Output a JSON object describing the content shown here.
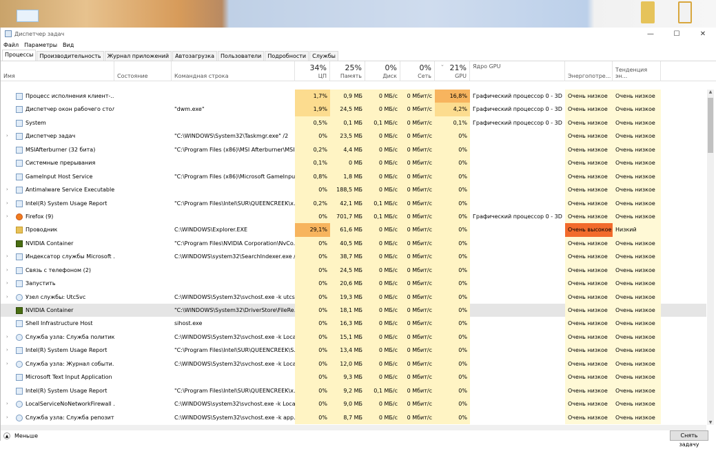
{
  "window": {
    "title": "Диспетчер задач",
    "controls": [
      "—",
      "☐",
      "✕"
    ]
  },
  "menu": [
    "Файл",
    "Параметры",
    "Вид"
  ],
  "tabs": [
    "Процессы",
    "Производительность",
    "Журнал приложений",
    "Автозагрузка",
    "Пользователи",
    "Подробности",
    "Службы"
  ],
  "columns": {
    "name": "Имя",
    "status": "Состояние",
    "cmd": "Командная строка",
    "cpu": {
      "pct": "34%",
      "label": "ЦП"
    },
    "mem": {
      "pct": "25%",
      "label": "Память"
    },
    "disk": {
      "pct": "0%",
      "label": "Диск"
    },
    "net": {
      "pct": "0%",
      "label": "Сеть"
    },
    "gpu": {
      "pct": "21%",
      "label": "GPU"
    },
    "gpuengine": "Ядро GPU",
    "power": "Энергопотре...",
    "trend": "Тенденция эн..."
  },
  "processes": [
    {
      "name": "Процесс исполнения клиент-...",
      "icon": "app-icon",
      "expand": false,
      "cmd": "",
      "cpu": "1,7%",
      "mem": "0,9 МБ",
      "disk": "0 МБ/с",
      "net": "0 Мбит/с",
      "gpu": "16,8%",
      "engine": "Графический процессор 0 - 3D",
      "power": "Очень низкое",
      "trend": "Очень низкое"
    },
    {
      "name": "Диспетчер окон рабочего стола",
      "icon": "app-icon",
      "expand": false,
      "cmd": "\"dwm.exe\"",
      "cpu": "1,9%",
      "mem": "24,5 МБ",
      "disk": "0 МБ/с",
      "net": "0 Мбит/с",
      "gpu": "4,2%",
      "engine": "Графический процессор 0 - 3D",
      "power": "Очень низкое",
      "trend": "Очень низкое"
    },
    {
      "name": "System",
      "icon": "app-icon",
      "expand": false,
      "cmd": "",
      "cpu": "0,5%",
      "mem": "0,1 МБ",
      "disk": "0,1 МБ/с",
      "net": "0 Мбит/с",
      "gpu": "0,1%",
      "engine": "Графический процессор 0 - 3D",
      "power": "Очень низкое",
      "trend": "Очень низкое"
    },
    {
      "name": "Диспетчер задач",
      "icon": "taskmgr-icon",
      "expand": true,
      "cmd": "\"C:\\WINDOWS\\System32\\Taskmgr.exe\" /2",
      "cpu": "0%",
      "mem": "23,5 МБ",
      "disk": "0 МБ/с",
      "net": "0 Мбит/с",
      "gpu": "0%",
      "engine": "",
      "power": "Очень низкое",
      "trend": "Очень низкое"
    },
    {
      "name": "MSIAfterburner (32 бита)",
      "icon": "app-icon",
      "expand": false,
      "cmd": "\"C:\\Program Files (x86)\\MSI Afterburner\\MSI...",
      "cpu": "0,2%",
      "mem": "4,4 МБ",
      "disk": "0 МБ/с",
      "net": "0 Мбит/с",
      "gpu": "0%",
      "engine": "",
      "power": "Очень низкое",
      "trend": "Очень низкое"
    },
    {
      "name": "Системные прерывания",
      "icon": "app-icon",
      "expand": false,
      "cmd": "",
      "cpu": "0,1%",
      "mem": "0 МБ",
      "disk": "0 МБ/с",
      "net": "0 Мбит/с",
      "gpu": "0%",
      "engine": "",
      "power": "Очень низкое",
      "trend": "Очень низкое"
    },
    {
      "name": "GameInput Host Service",
      "icon": "app-icon",
      "expand": false,
      "cmd": "\"C:\\Program Files (x86)\\Microsoft GameInpu...",
      "cpu": "0,8%",
      "mem": "1,8 МБ",
      "disk": "0 МБ/с",
      "net": "0 Мбит/с",
      "gpu": "0%",
      "engine": "",
      "power": "Очень низкое",
      "trend": "Очень низкое"
    },
    {
      "name": "Antimalware Service Executable",
      "icon": "app-icon",
      "expand": true,
      "cmd": "",
      "cpu": "0%",
      "mem": "188,5 МБ",
      "disk": "0 МБ/с",
      "net": "0 Мбит/с",
      "gpu": "0%",
      "engine": "",
      "power": "Очень низкое",
      "trend": "Очень низкое"
    },
    {
      "name": "Intel(R) System Usage Report",
      "icon": "app-icon",
      "expand": true,
      "cmd": "\"C:\\Program Files\\Intel\\SUR\\QUEENCREEK\\x...",
      "cpu": "0,2%",
      "mem": "42,1 МБ",
      "disk": "0,1 МБ/с",
      "net": "0 Мбит/с",
      "gpu": "0%",
      "engine": "",
      "power": "Очень низкое",
      "trend": "Очень низкое"
    },
    {
      "name": "Firefox (9)",
      "icon": "firefox-icon",
      "expand": true,
      "cmd": "",
      "cpu": "0%",
      "mem": "701,7 МБ",
      "disk": "0,1 МБ/с",
      "net": "0 Мбит/с",
      "gpu": "0%",
      "engine": "Графический процессор 0 - 3D",
      "power": "Очень низкое",
      "trend": "Очень низкое"
    },
    {
      "name": "Проводник",
      "icon": "folder-icon",
      "expand": false,
      "cmd": "C:\\WINDOWS\\Explorer.EXE",
      "cpu": "29,1%",
      "mem": "61,6 МБ",
      "disk": "0 МБ/с",
      "net": "0 Мбит/с",
      "gpu": "0%",
      "engine": "",
      "power": "Очень высокое",
      "trend": "Низкий"
    },
    {
      "name": "NVIDIA Container",
      "icon": "nvidia-icon",
      "expand": false,
      "cmd": "\"C:\\Program Files\\NVIDIA Corporation\\NvCo...",
      "cpu": "0%",
      "mem": "40,5 МБ",
      "disk": "0 МБ/с",
      "net": "0 Мбит/с",
      "gpu": "0%",
      "engine": "",
      "power": "Очень низкое",
      "trend": "Очень низкое"
    },
    {
      "name": "Индексатор службы Microsoft ...",
      "icon": "app-icon",
      "expand": true,
      "cmd": "C:\\WINDOWS\\system32\\SearchIndexer.exe /...",
      "cpu": "0%",
      "mem": "38,7 МБ",
      "disk": "0 МБ/с",
      "net": "0 Мбит/с",
      "gpu": "0%",
      "engine": "",
      "power": "Очень низкое",
      "trend": "Очень низкое"
    },
    {
      "name": "Связь с телефоном (2)",
      "icon": "app-icon",
      "expand": true,
      "cmd": "",
      "cpu": "0%",
      "mem": "24,5 МБ",
      "disk": "0 МБ/с",
      "net": "0 Мбит/с",
      "gpu": "0%",
      "engine": "",
      "power": "Очень низкое",
      "trend": "Очень низкое"
    },
    {
      "name": "Запустить",
      "icon": "app-icon",
      "expand": true,
      "cmd": "",
      "cpu": "0%",
      "mem": "20,6 МБ",
      "disk": "0 МБ/с",
      "net": "0 Мбит/с",
      "gpu": "0%",
      "engine": "",
      "power": "Очень низкое",
      "trend": "Очень низкое"
    },
    {
      "name": "Узел службы: UtcSvc",
      "icon": "gear-icon",
      "expand": true,
      "cmd": "C:\\WINDOWS\\System32\\svchost.exe -k utcs...",
      "cpu": "0%",
      "mem": "19,3 МБ",
      "disk": "0 МБ/с",
      "net": "0 Мбит/с",
      "gpu": "0%",
      "engine": "",
      "power": "Очень низкое",
      "trend": "Очень низкое"
    },
    {
      "name": "NVIDIA Container",
      "icon": "nvidia-icon",
      "expand": false,
      "cmd": "\"C:\\WINDOWS\\System32\\DriverStore\\FileRe...",
      "cpu": "0%",
      "mem": "18,1 МБ",
      "disk": "0 МБ/с",
      "net": "0 Мбит/с",
      "gpu": "0%",
      "engine": "",
      "power": "Очень низкое",
      "trend": "Очень низкое",
      "selected": true
    },
    {
      "name": "Shell Infrastructure Host",
      "icon": "app-icon",
      "expand": false,
      "cmd": "sihost.exe",
      "cpu": "0%",
      "mem": "16,3 МБ",
      "disk": "0 МБ/с",
      "net": "0 Мбит/с",
      "gpu": "0%",
      "engine": "",
      "power": "Очень низкое",
      "trend": "Очень низкое"
    },
    {
      "name": "Служба узла: Служба политик...",
      "icon": "gear-icon",
      "expand": true,
      "cmd": "C:\\WINDOWS\\System32\\svchost.exe -k Loca...",
      "cpu": "0%",
      "mem": "15,1 МБ",
      "disk": "0 МБ/с",
      "net": "0 Мбит/с",
      "gpu": "0%",
      "engine": "",
      "power": "Очень низкое",
      "trend": "Очень низкое"
    },
    {
      "name": "Intel(R) System Usage Report",
      "icon": "app-icon",
      "expand": true,
      "cmd": "\"C:\\Program Files\\Intel\\SUR\\QUEENCREEK\\S...",
      "cpu": "0%",
      "mem": "13,4 МБ",
      "disk": "0 МБ/с",
      "net": "0 Мбит/с",
      "gpu": "0%",
      "engine": "",
      "power": "Очень низкое",
      "trend": "Очень низкое"
    },
    {
      "name": "Служба узла: Журнал событи...",
      "icon": "gear-icon",
      "expand": true,
      "cmd": "C:\\WINDOWS\\System32\\svchost.exe -k Loca...",
      "cpu": "0%",
      "mem": "12,0 МБ",
      "disk": "0 МБ/с",
      "net": "0 Мбит/с",
      "gpu": "0%",
      "engine": "",
      "power": "Очень низкое",
      "trend": "Очень низкое"
    },
    {
      "name": "Microsoft Text Input Application",
      "icon": "app-icon",
      "expand": false,
      "cmd": "",
      "cpu": "0%",
      "mem": "9,3 МБ",
      "disk": "0 МБ/с",
      "net": "0 Мбит/с",
      "gpu": "0%",
      "engine": "",
      "power": "Очень низкое",
      "trend": "Очень низкое"
    },
    {
      "name": "Intel(R) System Usage Report",
      "icon": "app-icon",
      "expand": false,
      "cmd": "\"C:\\Program Files\\Intel\\SUR\\QUEENCREEK\\x...",
      "cpu": "0%",
      "mem": "9,2 МБ",
      "disk": "0,1 МБ/с",
      "net": "0 Мбит/с",
      "gpu": "0%",
      "engine": "",
      "power": "Очень низкое",
      "trend": "Очень низкое"
    },
    {
      "name": "LocalServiceNoNetworkFirewall ...",
      "icon": "gear-icon",
      "expand": true,
      "cmd": "C:\\WINDOWS\\system32\\svchost.exe -k Local...",
      "cpu": "0%",
      "mem": "9,0 МБ",
      "disk": "0 МБ/с",
      "net": "0 Мбит/с",
      "gpu": "0%",
      "engine": "",
      "power": "Очень низкое",
      "trend": "Очень низкое"
    },
    {
      "name": "Служба узла: Служба репозит...",
      "icon": "gear-icon",
      "expand": true,
      "cmd": "C:\\WINDOWS\\System32\\svchost.exe -k app...",
      "cpu": "0%",
      "mem": "8,7 МБ",
      "disk": "0 МБ/с",
      "net": "0 Мбит/с",
      "gpu": "0%",
      "engine": "",
      "power": "Очень низкое",
      "trend": "Очень низкое"
    }
  ],
  "footer": {
    "less": "Меньше",
    "endtask": "Снять задачу"
  }
}
